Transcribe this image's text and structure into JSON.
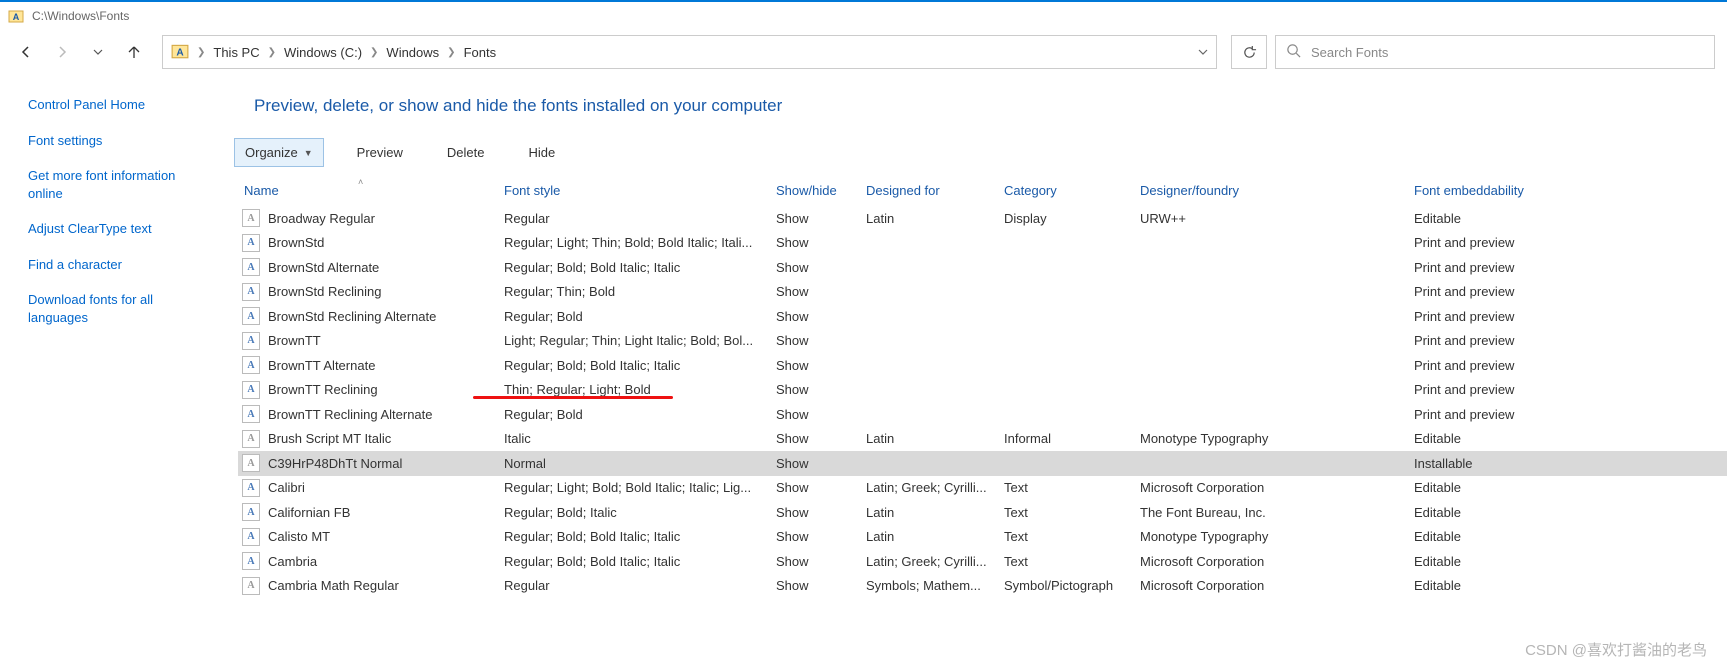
{
  "window": {
    "title": "C:\\Windows\\Fonts"
  },
  "breadcrumbs": [
    "This PC",
    "Windows (C:)",
    "Windows",
    "Fonts"
  ],
  "search": {
    "placeholder": "Search Fonts"
  },
  "sidebar": {
    "items": [
      "Control Panel Home",
      "Font settings",
      "Get more font information online",
      "Adjust ClearType text",
      "Find a character",
      "Download fonts for all languages"
    ]
  },
  "main_header": "Preview, delete, or show and hide the fonts installed on your computer",
  "toolbar": {
    "organize": "Organize",
    "preview": "Preview",
    "delete": "Delete",
    "hide": "Hide"
  },
  "columns": {
    "name": "Name",
    "style": "Font style",
    "show": "Show/hide",
    "designed": "Designed for",
    "category": "Category",
    "foundry": "Designer/foundry",
    "embed": "Font embeddability"
  },
  "fonts": [
    {
      "icon": "dim",
      "name": "Broadway Regular",
      "style": "Regular",
      "show": "Show",
      "designed": "Latin",
      "category": "Display",
      "foundry": "URW++",
      "embed": "Editable"
    },
    {
      "icon": "a",
      "name": "BrownStd",
      "style": "Regular; Light; Thin; Bold; Bold Italic; Itali...",
      "show": "Show",
      "designed": "",
      "category": "",
      "foundry": "",
      "embed": "Print and preview"
    },
    {
      "icon": "a",
      "name": "BrownStd Alternate",
      "style": "Regular; Bold; Bold Italic; Italic",
      "show": "Show",
      "designed": "",
      "category": "",
      "foundry": "",
      "embed": "Print and preview"
    },
    {
      "icon": "a",
      "name": "BrownStd Reclining",
      "style": "Regular; Thin; Bold",
      "show": "Show",
      "designed": "",
      "category": "",
      "foundry": "",
      "embed": "Print and preview"
    },
    {
      "icon": "a",
      "name": "BrownStd Reclining Alternate",
      "style": "Regular; Bold",
      "show": "Show",
      "designed": "",
      "category": "",
      "foundry": "",
      "embed": "Print and preview"
    },
    {
      "icon": "a",
      "name": "BrownTT",
      "style": "Light; Regular; Thin; Light Italic; Bold; Bol...",
      "show": "Show",
      "designed": "",
      "category": "",
      "foundry": "",
      "embed": "Print and preview"
    },
    {
      "icon": "a",
      "name": "BrownTT Alternate",
      "style": "Regular; Bold; Bold Italic; Italic",
      "show": "Show",
      "designed": "",
      "category": "",
      "foundry": "",
      "embed": "Print and preview"
    },
    {
      "icon": "a",
      "name": "BrownTT Reclining",
      "style": "Thin; Regular; Light; Bold",
      "show": "Show",
      "designed": "",
      "category": "",
      "foundry": "",
      "embed": "Print and preview"
    },
    {
      "icon": "a",
      "name": "BrownTT Reclining Alternate",
      "style": "Regular; Bold",
      "show": "Show",
      "designed": "",
      "category": "",
      "foundry": "",
      "embed": "Print and preview"
    },
    {
      "icon": "dim",
      "name": "Brush Script MT Italic",
      "style": "Italic",
      "show": "Show",
      "designed": "Latin",
      "category": "Informal",
      "foundry": "Monotype Typography",
      "embed": "Editable"
    },
    {
      "icon": "dim",
      "name": "C39HrP48DhTt Normal",
      "style": "Normal",
      "show": "Show",
      "designed": "",
      "category": "",
      "foundry": "",
      "embed": "Installable",
      "selected": true
    },
    {
      "icon": "a",
      "name": "Calibri",
      "style": "Regular; Light; Bold; Bold Italic; Italic; Lig...",
      "show": "Show",
      "designed": "Latin; Greek; Cyrilli...",
      "category": "Text",
      "foundry": "Microsoft Corporation",
      "embed": "Editable"
    },
    {
      "icon": "a",
      "name": "Californian FB",
      "style": "Regular; Bold; Italic",
      "show": "Show",
      "designed": "Latin",
      "category": "Text",
      "foundry": "The Font Bureau, Inc.",
      "embed": "Editable"
    },
    {
      "icon": "a",
      "name": "Calisto MT",
      "style": "Regular; Bold; Bold Italic; Italic",
      "show": "Show",
      "designed": "Latin",
      "category": "Text",
      "foundry": "Monotype Typography",
      "embed": "Editable"
    },
    {
      "icon": "a",
      "name": "Cambria",
      "style": "Regular; Bold; Bold Italic; Italic",
      "show": "Show",
      "designed": "Latin; Greek; Cyrilli...",
      "category": "Text",
      "foundry": "Microsoft Corporation",
      "embed": "Editable"
    },
    {
      "icon": "dim",
      "name": "Cambria Math Regular",
      "style": "Regular",
      "show": "Show",
      "designed": "Symbols; Mathem...",
      "category": "Symbol/Pictograph",
      "foundry": "Microsoft Corporation",
      "embed": "Editable"
    }
  ],
  "watermark": "CSDN @喜欢打酱油的老鸟"
}
